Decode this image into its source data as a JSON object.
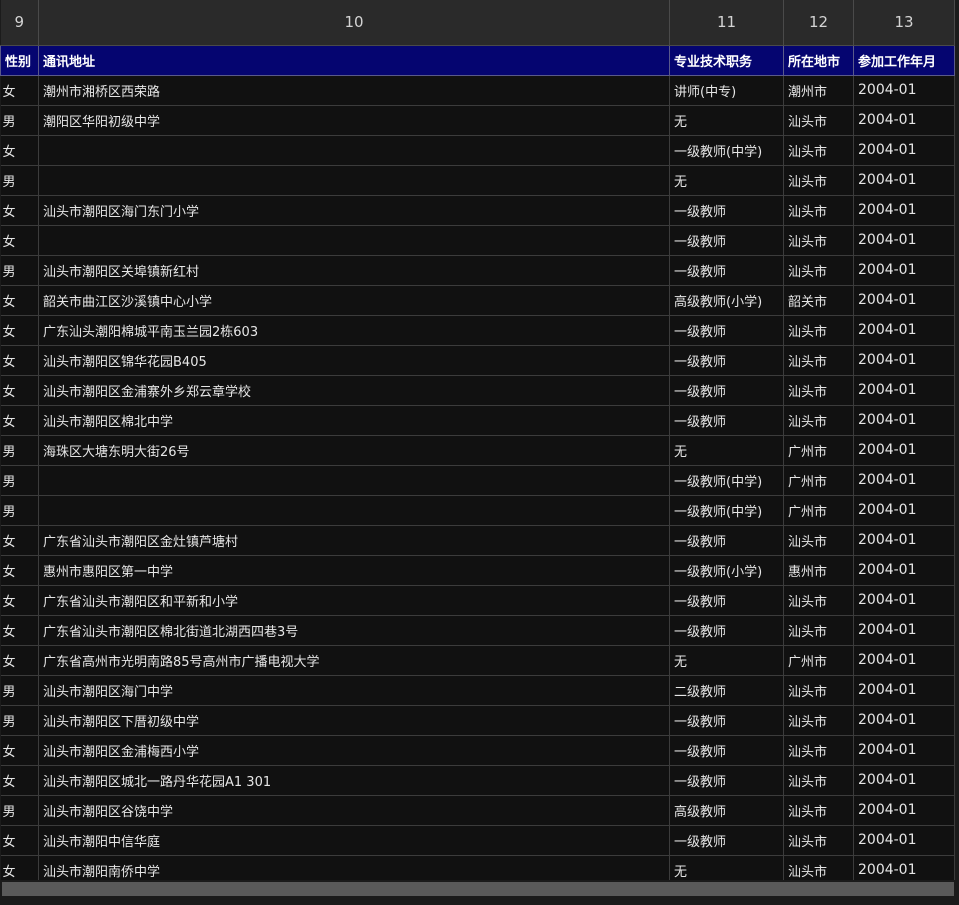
{
  "column_headers": [
    "9",
    "10",
    "11",
    "12",
    "13"
  ],
  "field_headers": [
    "性别",
    "通讯地址",
    "专业技术职务",
    "所在地市",
    "参加工作年月"
  ],
  "rows": [
    [
      "女",
      "潮州市湘桥区西荣路",
      "讲师(中专)",
      "潮州市",
      "2004-01"
    ],
    [
      "男",
      "潮阳区华阳初级中学",
      "无",
      "汕头市",
      "2004-01"
    ],
    [
      "女",
      "",
      "一级教师(中学)",
      "汕头市",
      "2004-01"
    ],
    [
      "男",
      "",
      "无",
      "汕头市",
      "2004-01"
    ],
    [
      "女",
      "汕头市潮阳区海门东门小学",
      "一级教师",
      "汕头市",
      "2004-01"
    ],
    [
      "女",
      "",
      "一级教师",
      "汕头市",
      "2004-01"
    ],
    [
      "男",
      "汕头市潮阳区关埠镇新红村",
      "一级教师",
      "汕头市",
      "2004-01"
    ],
    [
      "女",
      "韶关市曲江区沙溪镇中心小学",
      "高级教师(小学)",
      "韶关市",
      "2004-01"
    ],
    [
      "女",
      "广东汕头潮阳棉城平南玉兰园2栋603",
      "一级教师",
      "汕头市",
      "2004-01"
    ],
    [
      "女",
      "汕头市潮阳区锦华花园B405",
      "一级教师",
      "汕头市",
      "2004-01"
    ],
    [
      "女",
      "汕头市潮阳区金浦寨外乡郑云章学校",
      "一级教师",
      "汕头市",
      "2004-01"
    ],
    [
      "女",
      "汕头市潮阳区棉北中学",
      "一级教师",
      "汕头市",
      "2004-01"
    ],
    [
      "男",
      "海珠区大塘东明大街26号",
      "无",
      "广州市",
      "2004-01"
    ],
    [
      "男",
      "",
      "一级教师(中学)",
      "广州市",
      "2004-01"
    ],
    [
      "男",
      "",
      "一级教师(中学)",
      "广州市",
      "2004-01"
    ],
    [
      "女",
      "广东省汕头市潮阳区金灶镇芦塘村",
      "一级教师",
      "汕头市",
      "2004-01"
    ],
    [
      "女",
      "惠州市惠阳区第一中学",
      "一级教师(小学)",
      "惠州市",
      "2004-01"
    ],
    [
      "女",
      "广东省汕头市潮阳区和平新和小学",
      "一级教师",
      "汕头市",
      "2004-01"
    ],
    [
      "女",
      "广东省汕头市潮阳区棉北街道北湖西四巷3号",
      "一级教师",
      "汕头市",
      "2004-01"
    ],
    [
      "女",
      "广东省高州市光明南路85号高州市广播电视大学",
      "无",
      "广州市",
      "2004-01"
    ],
    [
      "男",
      "汕头市潮阳区海门中学",
      "二级教师",
      "汕头市",
      "2004-01"
    ],
    [
      "男",
      "汕头市潮阳区下厝初级中学",
      "一级教师",
      "汕头市",
      "2004-01"
    ],
    [
      "女",
      "汕头市潮阳区金浦梅西小学",
      "一级教师",
      "汕头市",
      "2004-01"
    ],
    [
      "女",
      "汕头市潮阳区城北一路丹华花园A1 301",
      "一级教师",
      "汕头市",
      "2004-01"
    ],
    [
      "男",
      "汕头市潮阳区谷饶中学",
      "高级教师",
      "汕头市",
      "2004-01"
    ],
    [
      "女",
      "汕头市潮阳中信华庭",
      "一级教师",
      "汕头市",
      "2004-01"
    ],
    [
      "女",
      "汕头市潮阳南侨中学",
      "无",
      "汕头市",
      "2004-01"
    ]
  ]
}
